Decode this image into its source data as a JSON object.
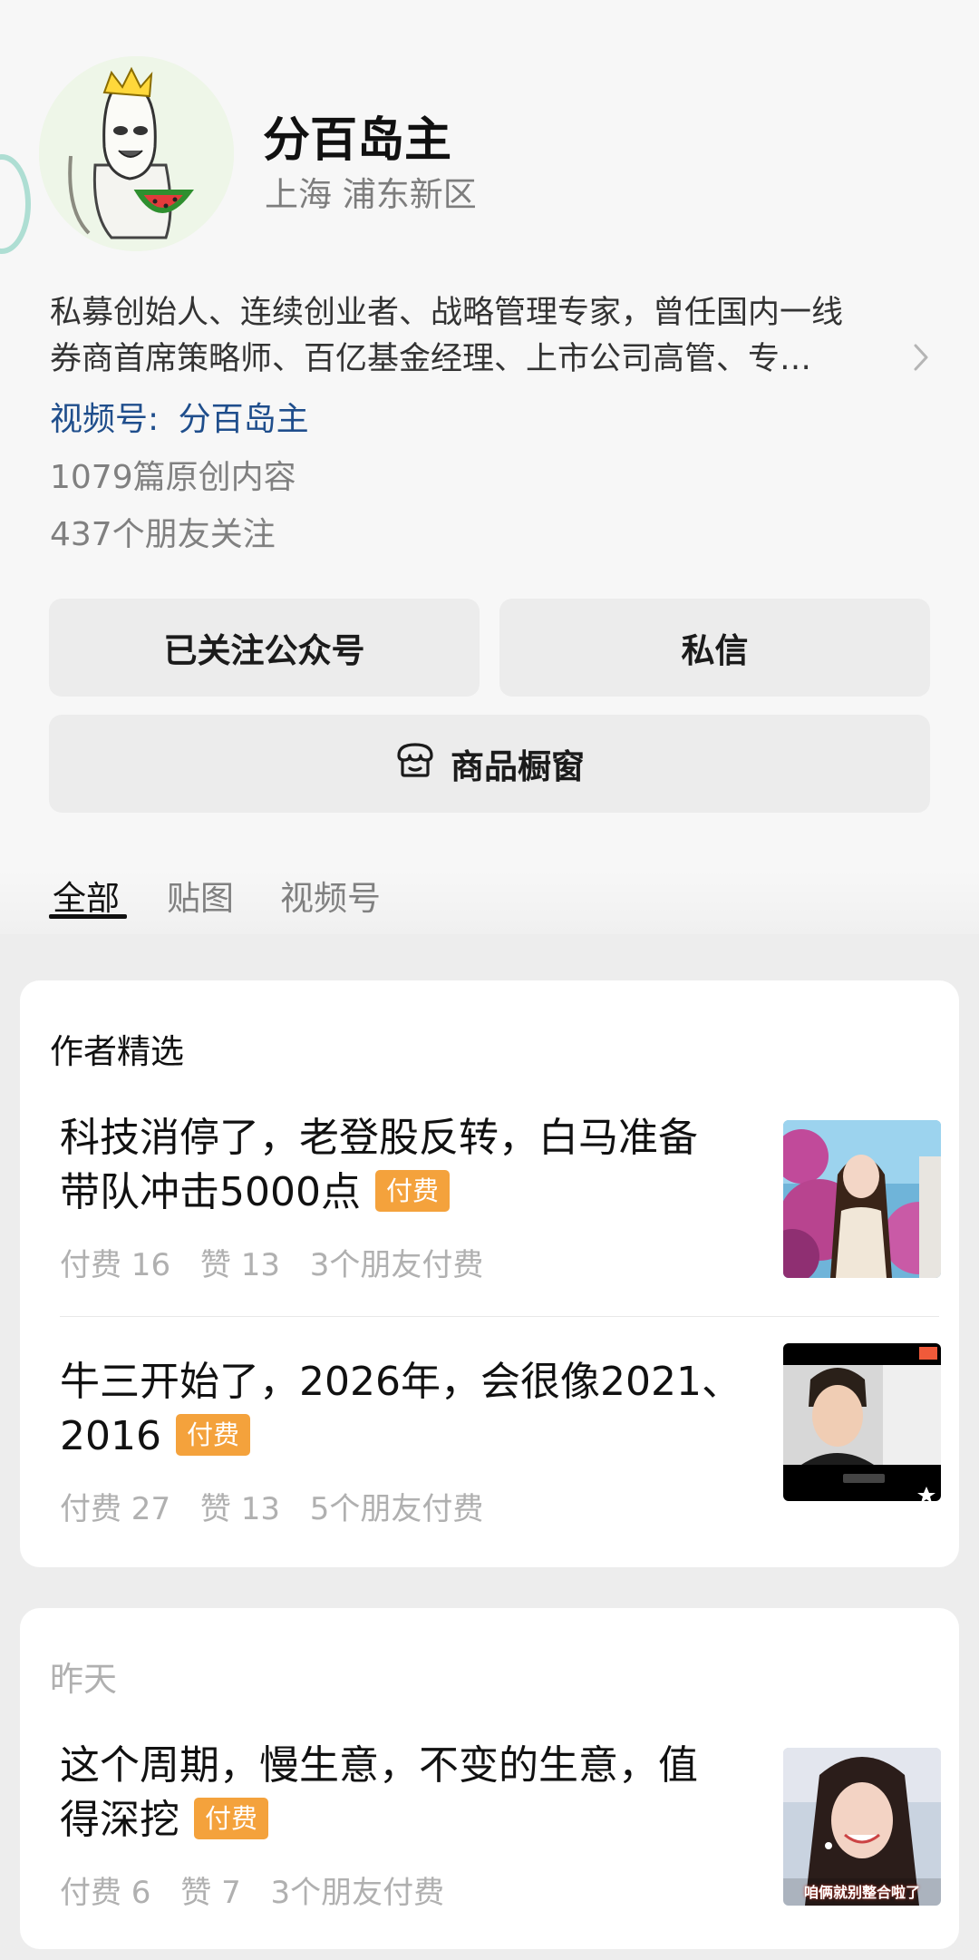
{
  "profile": {
    "name": "分百岛主",
    "location": "上海 浦东新区",
    "bio_line1": "私募创始人、连续创业者、战略管理专家，曾任国内一线",
    "bio_line2": "券商首席策略师、百亿基金经理、上市公司高管、专…",
    "channel_label": "视频号:",
    "channel_value": "分百岛主",
    "original_count": "1079篇原创内容",
    "friends_following": "437个朋友关注",
    "expand_icon": "chevron-right-icon"
  },
  "buttons": {
    "followed": "已关注公众号",
    "message": "私信",
    "shop": "商品橱窗",
    "shop_icon": "store-icon"
  },
  "tabs": [
    {
      "label": "全部",
      "active": true
    },
    {
      "label": "贴图",
      "active": false
    },
    {
      "label": "视频号",
      "active": false
    }
  ],
  "featured": {
    "header": "作者精选",
    "articles": [
      {
        "title_line1": "科技消停了，老登股反转，白马准备",
        "title_line2": "带队冲击5000点",
        "badge": "付费",
        "paid": "付费 16",
        "likes": "赞 13",
        "friends": "3个朋友付费"
      },
      {
        "title_line1": "牛三开始了，2026年，会很像2021、",
        "title_line2": "2016",
        "badge": "付费",
        "paid": "付费 27",
        "likes": "赞 13",
        "friends": "5个朋友付费"
      }
    ]
  },
  "recent": {
    "header": "昨天",
    "articles": [
      {
        "title_line1": "这个周期，慢生意，不变的生意，值",
        "title_line2": "得深挖",
        "badge": "付费",
        "paid": "付费 6",
        "likes": "赞 7",
        "friends": "3个朋友付费"
      }
    ]
  },
  "thumb3_caption": "咱俩就别整合啦了",
  "colors": {
    "badge": "#f4a23c",
    "link": "#1f4e8c"
  }
}
